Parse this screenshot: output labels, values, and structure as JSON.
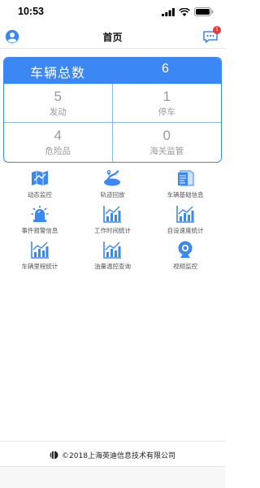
{
  "status_bar": {
    "time": "10:53"
  },
  "nav": {
    "title": "首页",
    "message_badge": "1"
  },
  "stats": {
    "total_label": "车辆总数",
    "total_value": "6",
    "cells": [
      {
        "value": "5",
        "label": "发动"
      },
      {
        "value": "1",
        "label": "停车"
      },
      {
        "value": "4",
        "label": "危险品"
      },
      {
        "value": "0",
        "label": "海关监管"
      }
    ]
  },
  "functions": [
    {
      "label": "动态监控",
      "icon": "map-icon"
    },
    {
      "label": "轨迹回放",
      "icon": "track-icon"
    },
    {
      "label": "车辆基础信息",
      "icon": "document-icon"
    },
    {
      "label": "事件报警信息",
      "icon": "alarm-icon"
    },
    {
      "label": "工作时间统计",
      "icon": "chart-icon"
    },
    {
      "label": "自设速度统计",
      "icon": "chart-icon"
    },
    {
      "label": "车辆里程统计",
      "icon": "chart-icon"
    },
    {
      "label": "油量温控查询",
      "icon": "chart-icon"
    },
    {
      "label": "视频监控",
      "icon": "camera-icon"
    }
  ],
  "footer": {
    "text": "©2018上海英迪信息技术有限公司"
  },
  "colors": {
    "primary": "#3b88f5",
    "muted_text": "#9a9a9a",
    "badge": "#e53935"
  }
}
